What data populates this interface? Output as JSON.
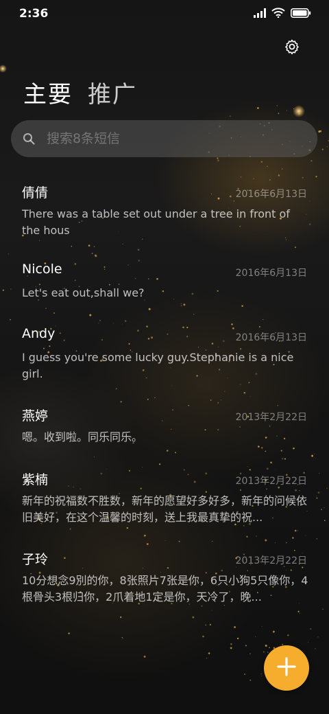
{
  "status_bar": {
    "time": "2:36",
    "icons": [
      "signal-icon",
      "wifi-icon",
      "battery-icon"
    ]
  },
  "header": {
    "settings_icon": "gear-icon",
    "tabs": [
      {
        "label": "主要",
        "active": true
      },
      {
        "label": "推广",
        "active": false
      }
    ]
  },
  "search": {
    "placeholder": "搜索8条短信",
    "icon": "search-icon"
  },
  "messages": [
    {
      "name": "倩倩",
      "date": "2016年6月13日",
      "preview": "There was a table set out under a tree in front of the hous"
    },
    {
      "name": "Nicole",
      "date": "2016年6月13日",
      "preview": "Let's eat out,shall we?"
    },
    {
      "name": "Andy",
      "date": "2016年6月13日",
      "preview": "I guess you're some lucky guy.Stephanie is a nice girl."
    },
    {
      "name": "燕婷",
      "date": "2013年2月22日",
      "preview": "嗯。收到啦。同乐同乐。"
    },
    {
      "name": "紫楠",
      "date": "2013年2月22日",
      "preview": "新年的祝福数不胜数，新年的愿望好多好多，新年的问候依旧美好，在这个温馨的时刻，送上我最真挚的祝..."
    },
    {
      "name": "子玲",
      "date": "2013年2月22日",
      "preview": "10分想念9別的你，8张照片7张是你，6只小狗5只像你，4根骨头3根归你，2爪着地1定是你，天冷了，晚..."
    }
  ],
  "fab": {
    "icon": "plus-icon"
  },
  "colors": {
    "accent": "#f6ad2e",
    "background": "#141414",
    "search_bg": "#5a5a5a"
  }
}
